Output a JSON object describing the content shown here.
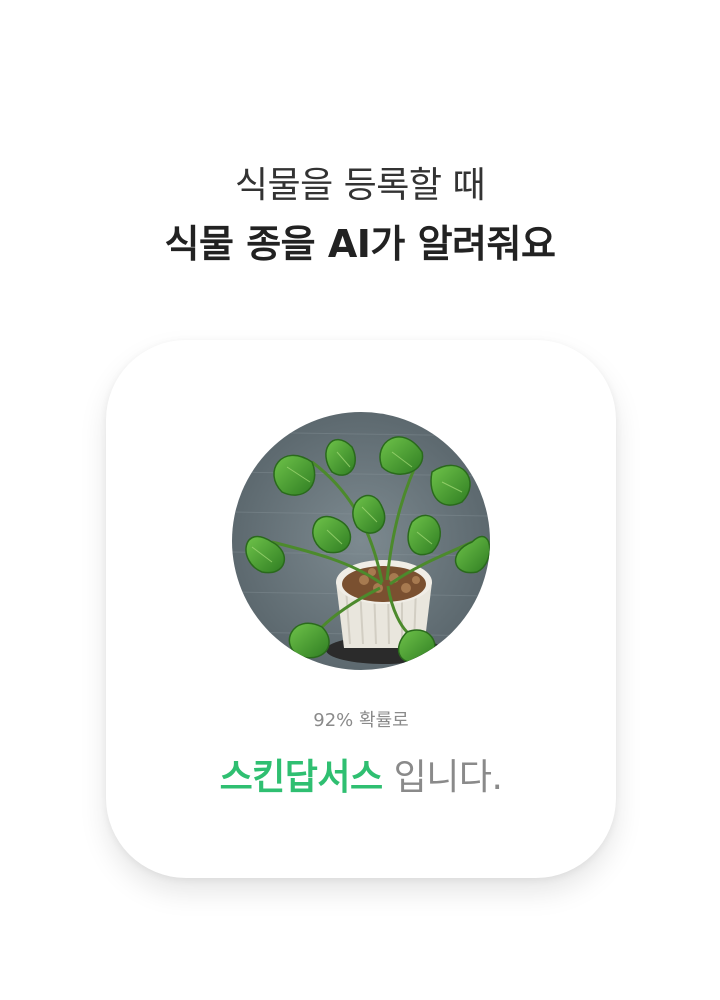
{
  "headline": {
    "line1": "식물을 등록할 때",
    "line2": "식물 종을 AI가 알려줘요"
  },
  "result_card": {
    "photo_icon": "potted-plant-photo",
    "probability_text": "92% 확률로",
    "species_name": "스킨답서스",
    "suffix_text": " 입니다.",
    "species_color": "#2fbf71"
  }
}
